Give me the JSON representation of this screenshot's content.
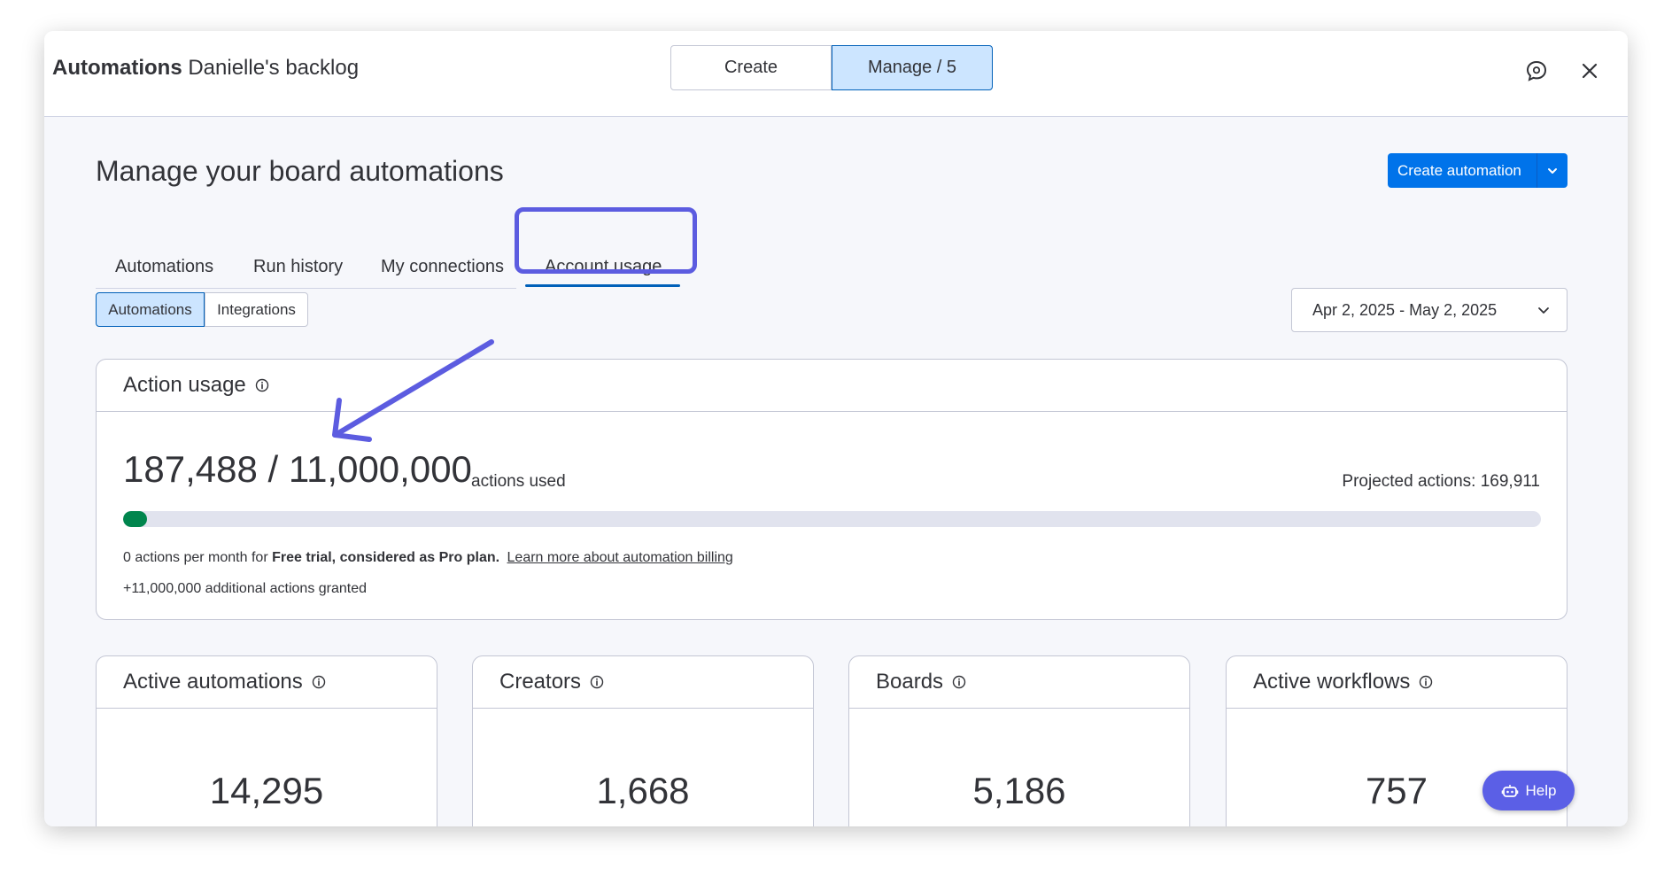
{
  "header": {
    "app_name": "Automations",
    "board_name": "Danielle's backlog",
    "segments": {
      "create_label": "Create",
      "manage_label": "Manage / 5"
    }
  },
  "icons": {
    "feedback": "chat-feedback-icon",
    "close": "close-icon",
    "dropdown": "chevron-down-icon",
    "info": "info-icon",
    "help": "robot-help-icon"
  },
  "page": {
    "title": "Manage your board automations",
    "create_button_label": "Create automation"
  },
  "tabs": [
    {
      "label": "Automations"
    },
    {
      "label": "Run history"
    },
    {
      "label": "My connections"
    },
    {
      "label": "Account usage",
      "active": true
    }
  ],
  "filters": {
    "chips": [
      {
        "label": "Automations",
        "selected": true
      },
      {
        "label": "Integrations"
      }
    ],
    "date_range": "Apr 2, 2025 - May 2, 2025"
  },
  "action_usage": {
    "title": "Action usage",
    "used_count": "187,488 / 11,000,000",
    "used_suffix": "actions used",
    "projected": "Projected actions: 169,911",
    "progress_fraction": 0.017,
    "plan_prefix": "0 actions per month for ",
    "plan_bold": "Free trial, considered as Pro plan.",
    "plan_link": "Learn more about automation billing",
    "granted": "+11,000,000 additional actions granted"
  },
  "stats": [
    {
      "title": "Active automations",
      "value": "14,295"
    },
    {
      "title": "Creators",
      "value": "1,668"
    },
    {
      "title": "Boards",
      "value": "5,186"
    },
    {
      "title": "Active workflows",
      "value": "757"
    }
  ],
  "help_label": "Help",
  "colors": {
    "primary": "#0073ea",
    "selected_bg": "#cce5ff",
    "progress": "#00854d",
    "annotation": "#5c5ce0"
  }
}
